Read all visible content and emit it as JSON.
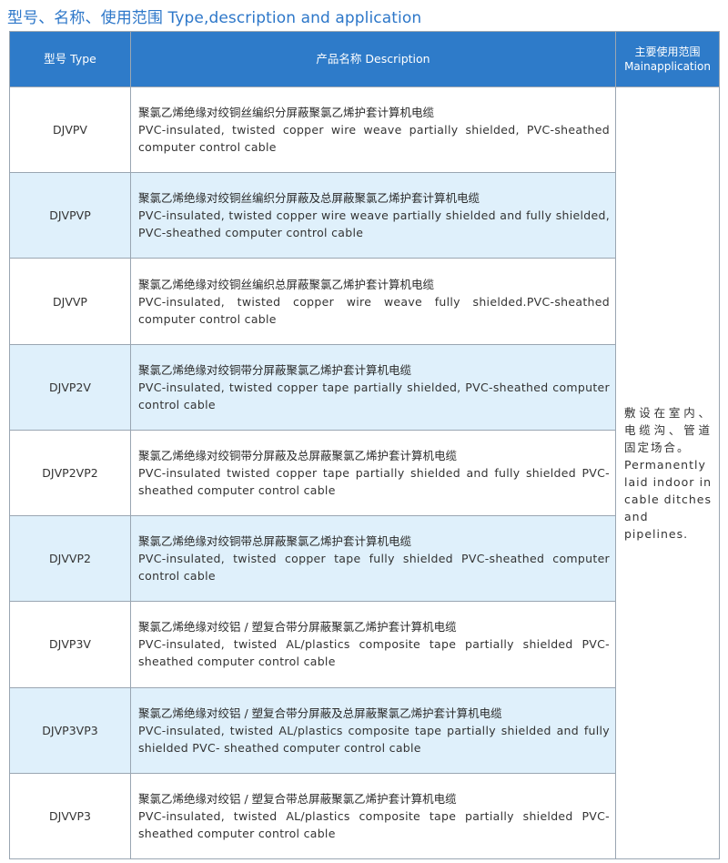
{
  "title": "型号、名称、使用范围 Type,description and application",
  "header": {
    "model": "型号 Type",
    "description": "产品名称 Description",
    "application_zh": "主要使用范围",
    "application_en": "Mainapplication"
  },
  "application": {
    "zh": "敷设在室内、电缆沟、管道固定场合。",
    "en": "Permanently laid indoor in cable ditches and pipelines."
  },
  "rows": [
    {
      "model": "DJVPV",
      "zh": "聚氯乙烯绝缘对绞铜丝编织分屏蔽聚氯乙烯护套计算机电缆",
      "en": "PVC-insulated, twisted copper wire weave partially shielded, PVC-sheathed computer control cable"
    },
    {
      "model": "DJVPVP",
      "zh": "聚氯乙烯绝缘对绞铜丝编织分屏蔽及总屏蔽聚氯乙烯护套计算机电缆",
      "en": "PVC-insulated, twisted copper wire weave partially shielded and fully shielded, PVC-sheathed computer control cable"
    },
    {
      "model": "DJVVP",
      "zh": "聚氯乙烯绝缘对绞铜丝编织总屏蔽聚氯乙烯护套计算机电缆",
      "en": "PVC-insulated, twisted copper wire weave fully shielded.PVC-sheathed computer control cable"
    },
    {
      "model": "DJVP2V",
      "zh": "聚氯乙烯绝缘对绞铜带分屏蔽聚氯乙烯护套计算机电缆",
      "en": "PVC-insulated, twisted copper tape partially shielded, PVC-sheathed computer control cable"
    },
    {
      "model": "DJVP2VP2",
      "zh": "聚氯乙烯绝缘对绞铜带分屏蔽及总屏蔽聚氯乙烯护套计算机电缆",
      "en": "PVC-insulated twisted copper tape partially shielded and fully shielded PVC-sheathed computer control cable"
    },
    {
      "model": "DJVVP2",
      "zh": "聚氯乙烯绝缘对绞铜带总屏蔽聚氯乙烯护套计算机电缆",
      "en": "PVC-insulated, twisted copper tape fully shielded PVC-sheathed computer control cable"
    },
    {
      "model": "DJVP3V",
      "zh": "聚氯乙烯绝缘对绞铝 / 塑复合带分屏蔽聚氯乙烯护套计算机电缆",
      "en": "PVC-insulated, twisted AL/plastics composite tape partially shielded PVC-sheathed computer control cable"
    },
    {
      "model": "DJVP3VP3",
      "zh": "聚氯乙烯绝缘对绞铝 / 塑复合带分屏蔽及总屏蔽聚氯乙烯护套计算机电缆",
      "en": "PVC-insulated, twisted AL/plastics composite tape partially shielded and fully shielded PVC- sheathed computer control cable"
    },
    {
      "model": "DJVVP3",
      "zh": "聚氯乙烯绝缘对绞铝 / 塑复合带总屏蔽聚氯乙烯护套计算机电缆",
      "en": "PVC-insulated, twisted AL/plastics composite tape partially shielded PVC-sheathed computer control cable"
    }
  ],
  "colors": {
    "title": "#2d77c9",
    "header_bg": "#2e7bc9",
    "shaded_row": "#dff0fb",
    "border": "#9aa6b2"
  }
}
